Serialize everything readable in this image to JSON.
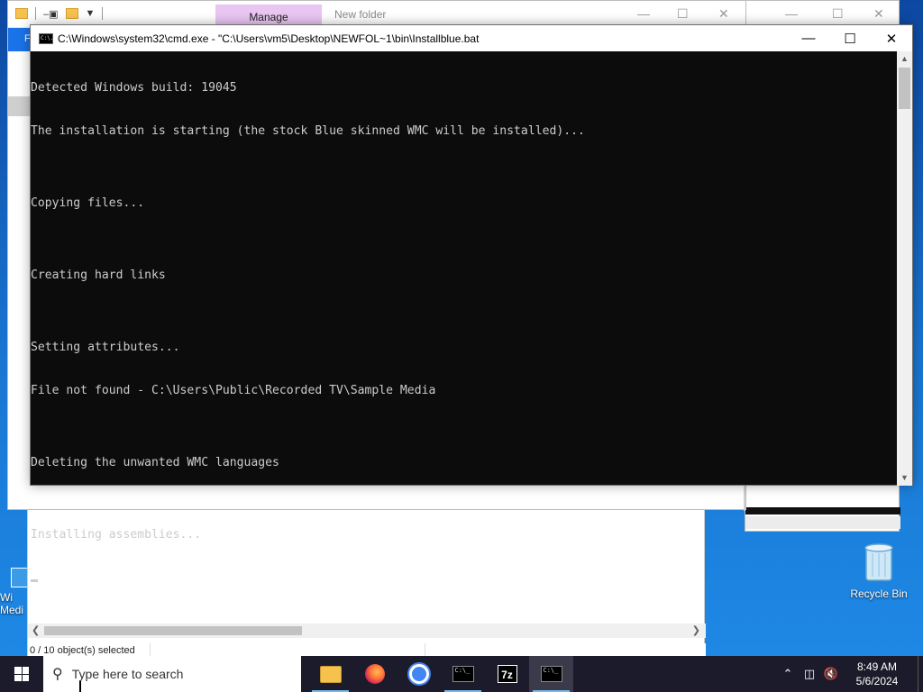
{
  "explorer_back": {
    "manage_tab": "Manage",
    "title": "New folder",
    "ribbon_letter": "F",
    "status_text": "0 / 10 object(s) selected"
  },
  "cmd": {
    "window_title": "C:\\Windows\\system32\\cmd.exe - \"C:\\Users\\vm5\\Desktop\\NEWFOL~1\\bin\\Installblue.bat",
    "icon_text": "C:\\.",
    "lines": [
      "Detected Windows build: 19045",
      "The installation is starting (the stock Blue skinned WMC will be installed)...",
      "",
      "Copying files...",
      "",
      "Creating hard links",
      "",
      "Setting attributes...",
      "File not found - C:\\Users\\Public\\Recorded TV\\Sample Media",
      "",
      "Deleting the unwanted WMC languages",
      "",
      "Installing assemblies..."
    ],
    "background": "#0c0c0c",
    "text_color": "#cccccc"
  },
  "desktop": {
    "recycle_bin_label": "Recycle Bin",
    "left_icon_label_1": "Wi",
    "left_icon_label_2": "Medi"
  },
  "taskbar": {
    "search_placeholder": "Type here to search",
    "apps": [
      "file-explorer",
      "firefox",
      "chrome",
      "cmd",
      "7-zip",
      "cmd"
    ],
    "seven_zip_label": "7z",
    "cmd_icon_text": "C:\\_",
    "clock_time": "8:49 AM",
    "clock_date": "5/6/2024",
    "accent": "#76b9ed"
  }
}
